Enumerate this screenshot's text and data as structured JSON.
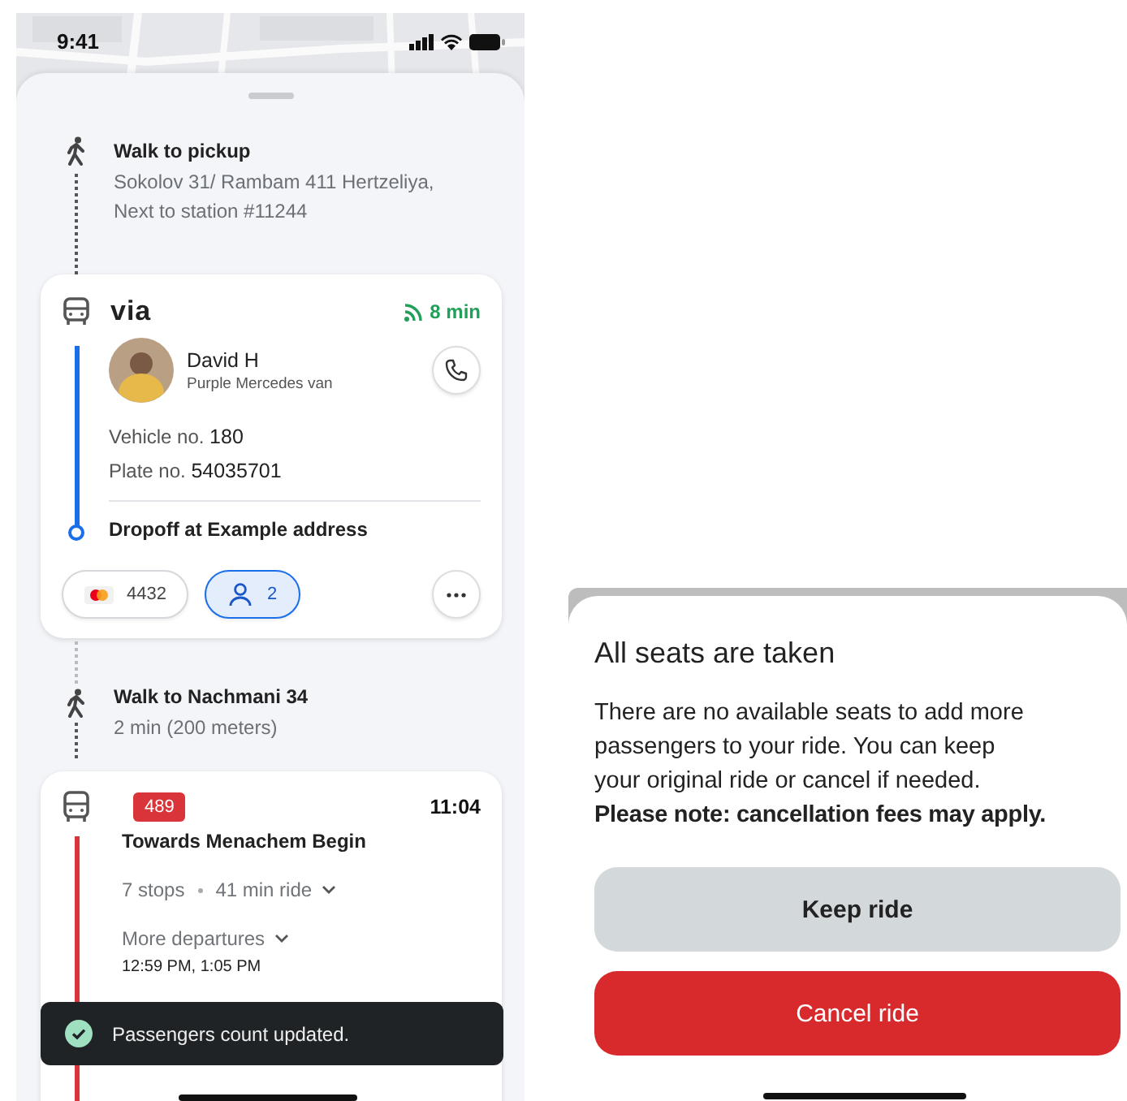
{
  "status_bar": {
    "time": "9:41"
  },
  "walk_to_pickup": {
    "title": "Walk to pickup",
    "address": "Sokolov 31/ Rambam 411 Hertzeliya,\nNext to station #11244"
  },
  "ride": {
    "brand": "via",
    "eta": "8 min",
    "driver": {
      "name": "David H",
      "vehicle": "Purple Mercedes van"
    },
    "vehicle_no": {
      "label": "Vehicle no.",
      "value": "180"
    },
    "plate_no": {
      "label": "Plate no.",
      "value": "54035701"
    },
    "dropoff": "Dropoff at Example address",
    "payment": {
      "card": "4432"
    },
    "passengers": {
      "count": "2",
      "selected": true
    }
  },
  "walk_to_stop": {
    "title": "Walk to Nachmani 34",
    "detail": "2 min (200 meters)"
  },
  "bus": {
    "route": "489",
    "time": "11:04",
    "direction": "Towards Menachem Begin",
    "stops": "7 stops",
    "duration": "41 min ride",
    "more_departures": "More departures",
    "departures": "12:59 PM, 1:05 PM"
  },
  "toast": {
    "message": "Passengers count updated."
  },
  "dialog": {
    "title": "All seats are taken",
    "body": "There are no available seats to add more passengers to your ride. You can keep your original ride or cancel if needed. **Please note: cancellation fees may apply.**",
    "buttons": [
      {
        "label": "Keep ride",
        "kind": "secondary"
      },
      {
        "label": "Cancel ride",
        "kind": "danger"
      }
    ]
  }
}
